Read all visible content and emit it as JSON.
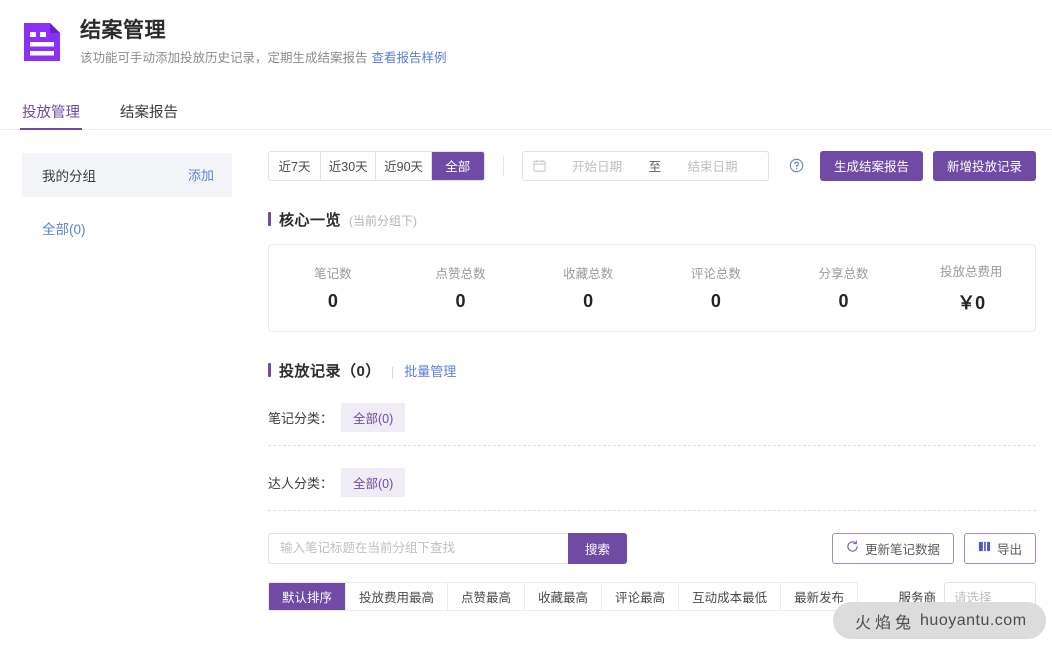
{
  "header": {
    "icon": "document-form-icon",
    "title": "结案管理",
    "subtitle": "该功能可手动添加投放历史记录，定期生成结案报告",
    "sample_link": "查看报告样例"
  },
  "tabs": [
    {
      "label": "投放管理",
      "active": true
    },
    {
      "label": "结案报告",
      "active": false
    }
  ],
  "sidebar": {
    "group_header": "我的分组",
    "add_label": "添加",
    "items": [
      {
        "label": "全部(0)"
      }
    ]
  },
  "filters": {
    "ranges": [
      {
        "label": "近7天",
        "active": false
      },
      {
        "label": "近30天",
        "active": false
      },
      {
        "label": "近90天",
        "active": false
      },
      {
        "label": "全部",
        "active": true
      }
    ],
    "date": {
      "calendar_icon": "calendar-icon",
      "start_placeholder": "开始日期",
      "separator": "至",
      "end_placeholder": "结束日期"
    },
    "help_icon": "question-circle-icon",
    "generate_report_label": "生成结案报告",
    "add_record_label": "新增投放记录"
  },
  "core": {
    "title": "核心一览",
    "note": "(当前分组下)",
    "stats": [
      {
        "label": "笔记数",
        "value": "0"
      },
      {
        "label": "点赞总数",
        "value": "0"
      },
      {
        "label": "收藏总数",
        "value": "0"
      },
      {
        "label": "评论总数",
        "value": "0"
      },
      {
        "label": "分享总数",
        "value": "0"
      },
      {
        "label": "投放总费用",
        "value": "￥0"
      }
    ]
  },
  "records": {
    "title": "投放记录（0）",
    "pipe": "|",
    "batch_link": "批量管理",
    "note_category_label": "笔记分类：",
    "note_category_chip": "全部(0)",
    "talent_category_label": "达人分类：",
    "talent_category_chip": "全部(0)",
    "search_placeholder": "输入笔记标题在当前分组下查找",
    "search_value": "",
    "search_button": "搜索",
    "refresh_label": "更新笔记数据",
    "refresh_icon": "refresh-circle-icon",
    "export_label": "导出",
    "export_icon": "excel-export-icon",
    "sorts": [
      {
        "label": "默认排序",
        "active": true
      },
      {
        "label": "投放费用最高",
        "active": false
      },
      {
        "label": "点赞最高",
        "active": false
      },
      {
        "label": "收藏最高",
        "active": false
      },
      {
        "label": "评论最高",
        "active": false
      },
      {
        "label": "互动成本最低",
        "active": false
      },
      {
        "label": "最新发布",
        "active": false
      }
    ],
    "provider_label": "服务商",
    "provider_placeholder": "请选择"
  },
  "watermark": {
    "cn": "火焰兔",
    "en": "huoyantu.com"
  },
  "colors": {
    "accent_purple": "#6f4ba5",
    "link_blue": "#5a7fd6",
    "chip_bg": "#efecf5",
    "panel_gray": "#f3f5f8"
  }
}
